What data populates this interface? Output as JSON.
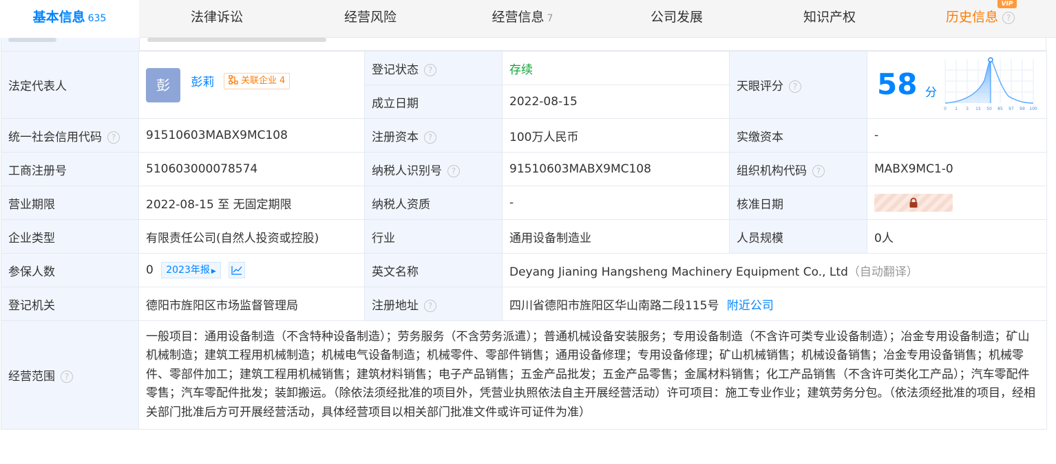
{
  "tabs": [
    {
      "label": "基本信息",
      "count": "635",
      "active": true
    },
    {
      "label": "法律诉讼",
      "count": "",
      "active": false
    },
    {
      "label": "经营风险",
      "count": "",
      "active": false
    },
    {
      "label": "经营信息",
      "count": "7",
      "active": false
    },
    {
      "label": "公司发展",
      "count": "",
      "active": false
    },
    {
      "label": "知识产权",
      "count": "",
      "active": false
    },
    {
      "label": "历史信息",
      "count": "",
      "active": false
    }
  ],
  "vip_badge": "VIP",
  "help_icon": "?",
  "legal_rep": {
    "label": "法定代表人",
    "avatar_char": "彭",
    "name": "彭莉",
    "related_label": "关联企业",
    "related_count": "4"
  },
  "reg_status": {
    "label": "登记状态",
    "value": "存续"
  },
  "found_date": {
    "label": "成立日期",
    "value": "2022-08-15"
  },
  "tianyan": {
    "label": "天眼评分",
    "score": "58",
    "unit": "分",
    "axis": [
      "0",
      "1",
      "3",
      "15",
      "50",
      "85",
      "97",
      "99",
      "100"
    ]
  },
  "credit_code": {
    "label": "统一社会信用代码",
    "value": "91510603MABX9MC108"
  },
  "reg_capital": {
    "label": "注册资本",
    "value": "100万人民币"
  },
  "paid_capital": {
    "label": "实缴资本",
    "value": "-"
  },
  "biz_reg_no": {
    "label": "工商注册号",
    "value": "510603000078574"
  },
  "taxpayer_id": {
    "label": "纳税人识别号",
    "value": "91510603MABX9MC108"
  },
  "org_code": {
    "label": "组织机构代码",
    "value": "MABX9MC1-0"
  },
  "biz_term": {
    "label": "营业期限",
    "value": "2022-08-15 至 无固定期限"
  },
  "taxpayer_qual": {
    "label": "纳税人资质",
    "value": "-"
  },
  "approve_date": {
    "label": "核准日期"
  },
  "company_type": {
    "label": "企业类型",
    "value": "有限责任公司(自然人投资或控股)"
  },
  "industry": {
    "label": "行业",
    "value": "通用设备制造业"
  },
  "staff_size": {
    "label": "人员规模",
    "value": "0人"
  },
  "insured": {
    "label": "参保人数",
    "value": "0",
    "report": "2023年报"
  },
  "english_name": {
    "label": "英文名称",
    "value": "Deyang Jianing Hangsheng Machinery Equipment Co., Ltd",
    "note": "（自动翻译）"
  },
  "reg_authority": {
    "label": "登记机关",
    "value": "德阳市旌阳区市场监督管理局"
  },
  "reg_address": {
    "label": "注册地址",
    "value": "四川省德阳市旌阳区华山南路二段115号",
    "nearby": "附近公司"
  },
  "biz_scope": {
    "label": "经营范围",
    "value": "一般项目：通用设备制造（不含特种设备制造）；劳务服务（不含劳务派遣）；普通机械设备安装服务；专用设备制造（不含许可类专业设备制造）；冶金专用设备制造；矿山机械制造；建筑工程用机械制造；机械电气设备制造；机械零件、零部件销售；通用设备修理；专用设备修理；矿山机械销售；机械设备销售；冶金专用设备销售；机械零件、零部件加工；建筑工程用机械销售；建筑材料销售；电子产品销售；五金产品批发；五金产品零售；金属材料销售；化工产品销售（不含许可类化工产品）；汽车零配件零售；汽车零配件批发；装卸搬运。（除依法须经批准的项目外，凭营业执照依法自主开展经营活动）许可项目：施工专业作业；建筑劳务分包。（依法须经批准的项目，经相关部门批准后方可开展经营活动，具体经营项目以相关部门批准文件或许可证件为准）"
  },
  "colors": {
    "accent": "#0084ff",
    "label_bg": "#f1f6fe",
    "status_green": "#13a538",
    "history_orange": "#ff7a00"
  }
}
